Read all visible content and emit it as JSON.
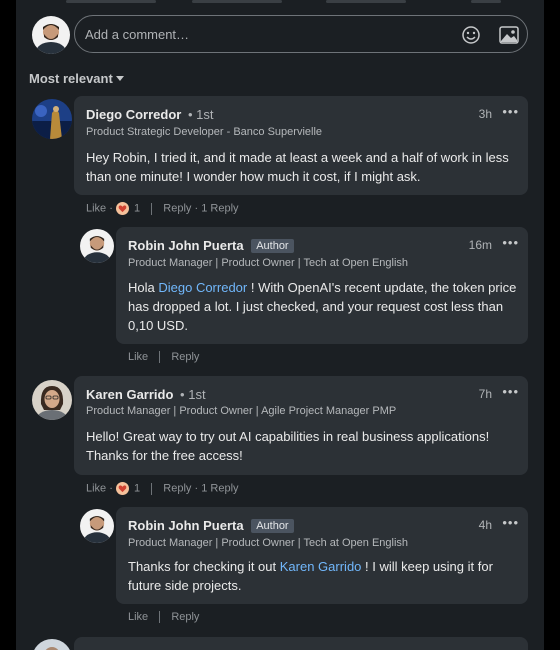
{
  "composer": {
    "placeholder": "Add a comment…"
  },
  "sort": {
    "label": "Most relevant"
  },
  "comments": [
    {
      "name": "Diego Corredor",
      "degree": "• 1st",
      "headline": "Product Strategic Developer - Banco Supervielle",
      "time": "3h",
      "text": "Hey Robin, I tried it, and it made at least a week and a half of work in less than one minute! I wonder how much it cost, if I might ask.",
      "like": "Like",
      "reaction_count": "1",
      "reply": "Reply",
      "replies": "1 Reply",
      "reply_item": {
        "name": "Robin John Puerta",
        "badge": "Author",
        "headline": "Product Manager | Product Owner | Tech at Open English",
        "time": "16m",
        "text_pre": "Hola ",
        "mention": "Diego Corredor",
        "text_post": " ! With OpenAI's recent update, the token price has dropped a lot. I just checked, and your request cost less than 0,10 USD.",
        "like": "Like",
        "reply": "Reply"
      }
    },
    {
      "name": "Karen Garrido",
      "degree": "• 1st",
      "headline": "Product Manager | Product Owner | Agile Project Manager PMP",
      "time": "7h",
      "text": "Hello! Great way to try out AI capabilities in real business applications! Thanks for the free access!",
      "like": "Like",
      "reaction_count": "1",
      "reply": "Reply",
      "replies": "1 Reply",
      "reply_item": {
        "name": "Robin John Puerta",
        "badge": "Author",
        "headline": "Product Manager | Product Owner | Tech at Open English",
        "time": "4h",
        "text_pre": "Thanks for checking it out ",
        "mention": "Karen Garrido",
        "text_post": " ! I will keep using it for future side projects.",
        "like": "Like",
        "reply": "Reply"
      }
    }
  ],
  "more_menu_glyph": "•••"
}
